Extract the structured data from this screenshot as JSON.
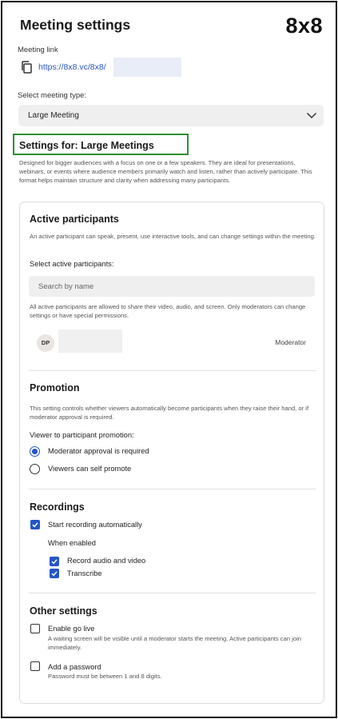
{
  "header": {
    "title": "Meeting settings",
    "logo": "8x8"
  },
  "meeting_link": {
    "label": "Meeting link",
    "url": "https://8x8.vc/8x8/",
    "icon": "copy-icon"
  },
  "meeting_type": {
    "label": "Select meeting type:",
    "value": "Large Meeting",
    "icon": "chevron-down-icon"
  },
  "settings": {
    "heading": "Settings for: Large Meetings",
    "description": "Designed for bigger audiences with a focus on one or a few speakers. They are ideal for presentations, webinars, or events where audience members primarily watch and listen, rather than actively participate. This format helps maintain structure and clarity when addressing many participants."
  },
  "active_participants": {
    "title": "Active participants",
    "description": "An active participant can speak, present, use interactive tools, and can change settings within the meeting.",
    "select_label": "Select active participants:",
    "search_placeholder": "Search by name",
    "note": "All active participants are allowed to share their video, audio, and screen. Only moderators can change settings or have special permissions.",
    "participants": [
      {
        "initials": "DP",
        "role": "Moderator"
      }
    ]
  },
  "promotion": {
    "title": "Promotion",
    "description": "This setting controls whether viewers automatically become participants when they raise their hand, or if moderator approval is required.",
    "label": "Viewer to participant promotion:",
    "options": [
      {
        "label": "Moderator approval is required",
        "selected": true
      },
      {
        "label": "Viewers can self promote",
        "selected": false
      }
    ]
  },
  "recordings": {
    "title": "Recordings",
    "start_auto": {
      "label": "Start recording automatically",
      "checked": true
    },
    "when_enabled": "When enabled",
    "sub_options": [
      {
        "label": "Record audio and video",
        "checked": true
      },
      {
        "label": "Transcribe",
        "checked": true
      }
    ]
  },
  "other": {
    "title": "Other settings",
    "go_live": {
      "label": "Enable go live",
      "checked": false,
      "hint": "A waiting screen will be visible until a moderator starts the meeting. Active participants can join immediately."
    },
    "password": {
      "label": "Add a password",
      "checked": false,
      "hint": "Password must be between 1 and 8 digits."
    }
  },
  "colors": {
    "accent": "#2456c5",
    "highlight_border": "#2c9131",
    "link": "#2b58c2"
  }
}
